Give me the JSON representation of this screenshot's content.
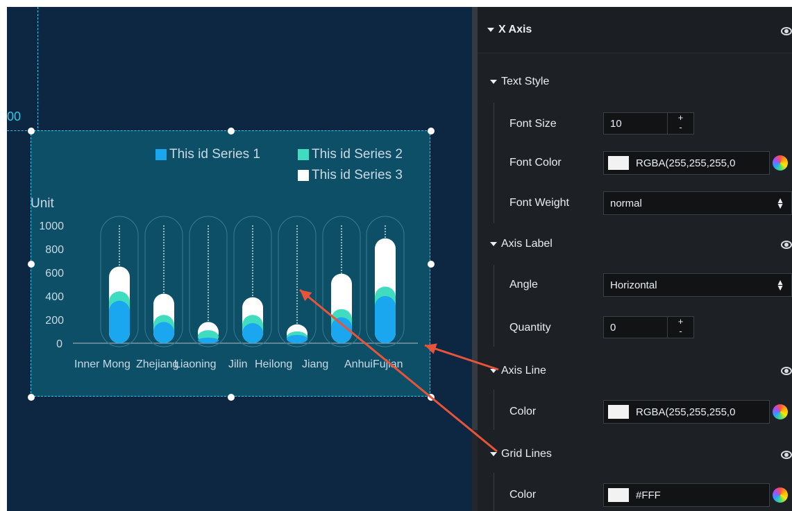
{
  "canvas": {
    "ruler_label": "00",
    "chart": {
      "legend": [
        {
          "label": "This id Series 1",
          "color": "#1aa7f0"
        },
        {
          "label": "This id Series 2",
          "color": "#3fdcc0"
        },
        {
          "label": "This id Series 3",
          "color": "#ffffff"
        }
      ],
      "y_unit": "Unit"
    }
  },
  "chart_data": {
    "type": "bar",
    "categories": [
      "Inner Mongolia",
      "Zhejiang",
      "Liaoning",
      "Jilin",
      "Heilongjiang",
      "Anhui",
      "Fujian"
    ],
    "tick_labels": [
      "Inner Mong",
      "Zhejiang",
      "Liaoning",
      "Jilin",
      "Heilong",
      "Jiang",
      "Anhui",
      "Fujian"
    ],
    "series": [
      {
        "name": "This id Series 1",
        "values": [
          360,
          180,
          40,
          170,
          70,
          220,
          400
        ]
      },
      {
        "name": "This id Series 2",
        "values": [
          80,
          60,
          70,
          70,
          30,
          70,
          80
        ]
      },
      {
        "name": "This id Series 3",
        "values": [
          210,
          180,
          70,
          150,
          60,
          300,
          410
        ]
      }
    ],
    "stacked": true,
    "ylabel": "Unit",
    "yticks": [
      0,
      200,
      400,
      600,
      800,
      1000
    ],
    "ylim": [
      0,
      1000
    ],
    "bar_style": "rounded-capsule",
    "background_capsules": true,
    "dashed_guides_to_max": true,
    "colors": {
      "series1": "#1aa7f0",
      "series2": "#3fdcc0",
      "series3": "#ffffff"
    }
  },
  "panel": {
    "x_axis": {
      "title": "X Axis"
    },
    "text_style": {
      "title": "Text Style",
      "font_size_label": "Font Size",
      "font_size_value": "10",
      "font_color_label": "Font Color",
      "font_color_value": "RGBA(255,255,255,0",
      "font_weight_label": "Font Weight",
      "font_weight_value": "normal"
    },
    "axis_label": {
      "title": "Axis Label",
      "angle_label": "Angle",
      "angle_value": "Horizontal",
      "quantity_label": "Quantity",
      "quantity_value": "0"
    },
    "axis_line": {
      "title": "Axis Line",
      "color_label": "Color",
      "color_value": "RGBA(255,255,255,0"
    },
    "grid_lines": {
      "title": "Grid Lines",
      "color_label": "Color",
      "color_value": "#FFF"
    },
    "stepper_plus": "+",
    "stepper_minus": "-"
  },
  "annotation_color": "#e8543a"
}
